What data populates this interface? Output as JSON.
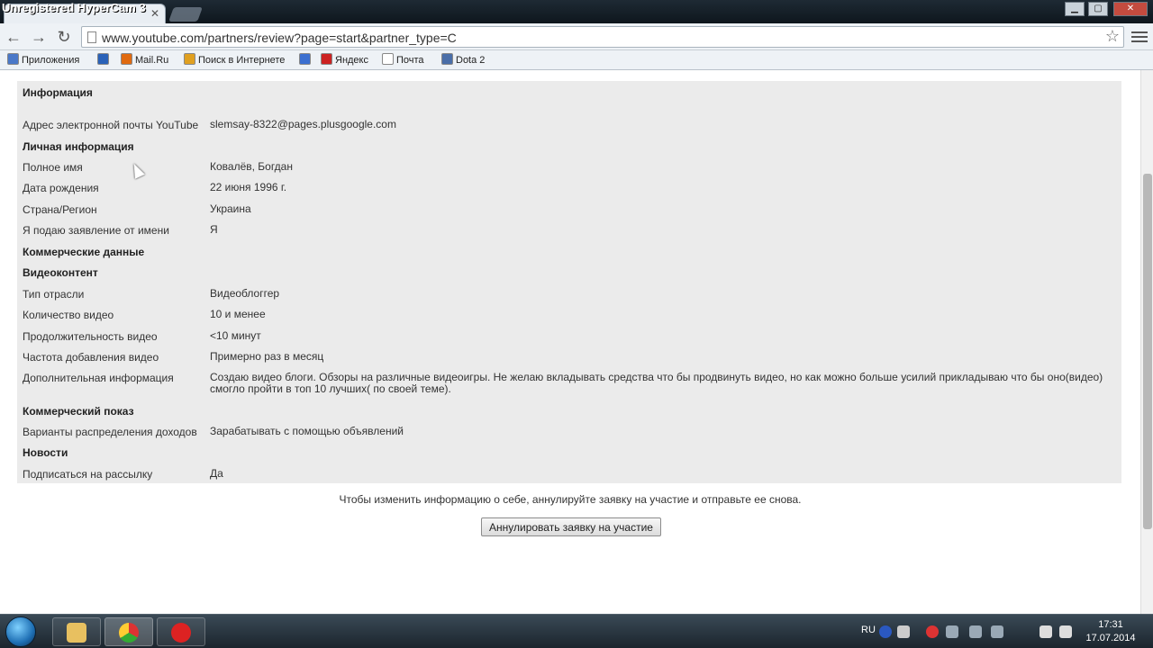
{
  "window": {
    "watermark": "Unregistered HyperCam 3",
    "tab_title": "Партнерская программа"
  },
  "browser": {
    "url": "www.youtube.com/partners/review?page=start&partner_type=C",
    "bookmarks": [
      {
        "label": "Приложения",
        "color": "#4a78c8"
      },
      {
        "label": "",
        "color": "#2a62b8"
      },
      {
        "label": "Mail.Ru",
        "color": "#e06a10"
      },
      {
        "label": "Поиск в Интернете",
        "color": "#e0a020"
      },
      {
        "label": "",
        "color": "#3b6fd0"
      },
      {
        "label": "Яндекс",
        "color": "#cc2222"
      },
      {
        "label": "Почта",
        "color": "#ffffff"
      },
      {
        "label": "Dota 2",
        "color": "#4a6ea8"
      }
    ]
  },
  "review": {
    "rows": [
      {
        "type": "section",
        "text": "Информация"
      },
      {
        "type": "field",
        "label": "Адрес электронной почты YouTube",
        "value": "slemsay-8322@pages.plusgoogle.com"
      },
      {
        "type": "section",
        "text": "Личная информация"
      },
      {
        "type": "field",
        "label": "Полное имя",
        "value": "Ковалёв, Богдан"
      },
      {
        "type": "field",
        "label": "Дата рождения",
        "value": "22 июня 1996 г."
      },
      {
        "type": "field",
        "label": "Страна/Регион",
        "value": "Украина"
      },
      {
        "type": "field",
        "label": "Я подаю заявление от имени",
        "value": "Я"
      },
      {
        "type": "section",
        "text": "Коммерческие данные"
      },
      {
        "type": "section",
        "text": "Видеоконтент"
      },
      {
        "type": "field",
        "label": "Тип отрасли",
        "value": "Видеоблоггер"
      },
      {
        "type": "field",
        "label": "Количество видео",
        "value": "10 и менее"
      },
      {
        "type": "field",
        "label": "Продолжительность видео",
        "value": "<10 минут"
      },
      {
        "type": "field",
        "label": "Частота добавления видео",
        "value": "Примерно раз в месяц"
      },
      {
        "type": "field",
        "label": "Дополнительная информация",
        "value": "Создаю видео блоги. Обзоры на различные видеоигры. Не желаю вкладывать средства что бы продвинуть видео, но как можно больше усилий прикладываю что бы оно(видео) смогло пройти в топ 10 лучших( по своей теме)."
      },
      {
        "type": "section",
        "text": "Коммерческий показ"
      },
      {
        "type": "field",
        "label": "Варианты распределения доходов",
        "value": "Зарабатывать с помощью объявлений"
      },
      {
        "type": "section",
        "text": "Новости"
      },
      {
        "type": "field",
        "label": "Подписаться на рассылку",
        "value": "Да"
      }
    ],
    "note": "Чтобы изменить информацию о себе, аннулируйте заявку на участие и отправьте ее снова.",
    "withdraw_button": "Аннулировать заявку на участие"
  },
  "taskbar": {
    "language": "RU",
    "time": "17:31",
    "date": "17.07.2014"
  }
}
